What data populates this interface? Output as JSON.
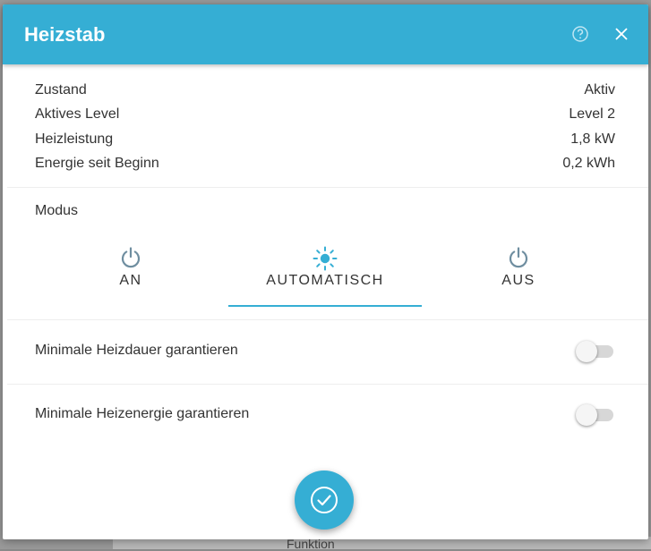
{
  "dialog": {
    "title": "Heizstab"
  },
  "info": [
    {
      "label": "Zustand",
      "value": "Aktiv"
    },
    {
      "label": "Aktives Level",
      "value": "Level 2"
    },
    {
      "label": "Heizleistung",
      "value": "1,8 kW"
    },
    {
      "label": "Energie seit Beginn",
      "value": "0,2 kWh"
    }
  ],
  "modus": {
    "label": "Modus",
    "options": [
      {
        "label": "AN",
        "icon": "power-icon"
      },
      {
        "label": "AUTOMATISCH",
        "icon": "sun-icon"
      },
      {
        "label": "AUS",
        "icon": "power-icon"
      }
    ],
    "selected": "AUTOMATISCH"
  },
  "toggles": [
    {
      "label": "Minimale Heizdauer garantieren",
      "enabled": false
    },
    {
      "label": "Minimale Heizenergie garantieren",
      "enabled": false
    }
  ],
  "background": {
    "partial_text": "Funktion"
  },
  "colors": {
    "accent": "#35aed4",
    "header_text": "#ffffff",
    "text": "#333333",
    "icon_inactive": "#6f8ea0"
  }
}
